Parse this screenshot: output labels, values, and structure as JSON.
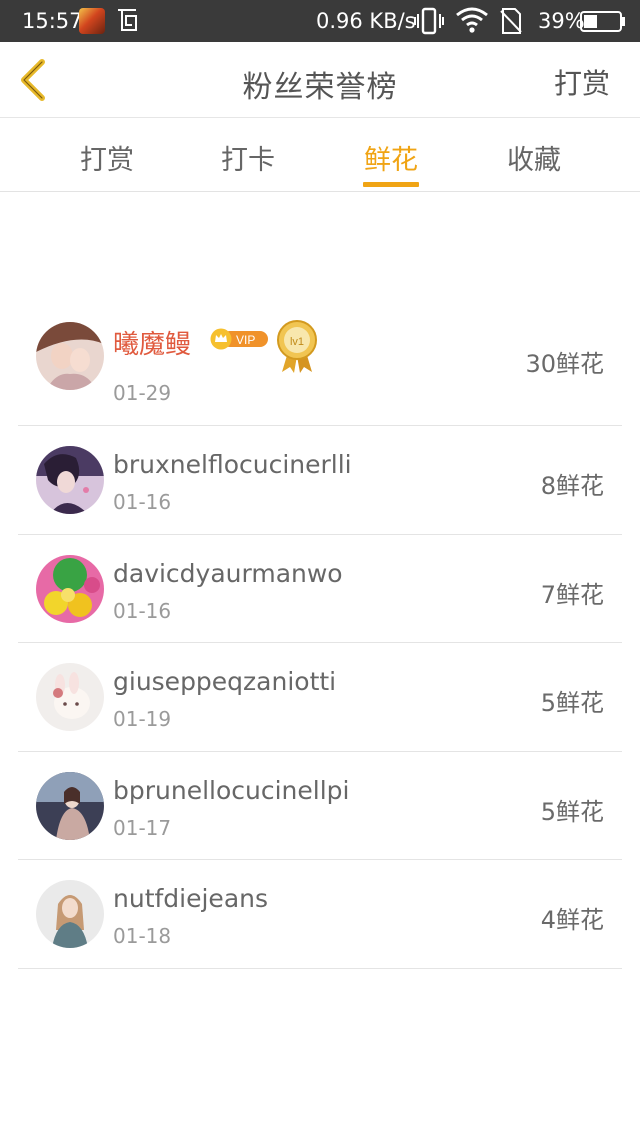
{
  "status_bar": {
    "time": "15:57",
    "speed": "0.96 KB/s",
    "battery_percent": "39%",
    "battery_level": 0.39,
    "icons": [
      "game-app-icon",
      "screenshot-icon",
      "vibrate-icon",
      "wifi-icon",
      "no-sim-icon",
      "battery-icon"
    ]
  },
  "header": {
    "title": "粉丝荣誉榜",
    "action_label": "打赏",
    "back_icon": "chevron-left-icon"
  },
  "tabs": [
    {
      "label": "打赏",
      "active": false
    },
    {
      "label": "打卡",
      "active": false
    },
    {
      "label": "鲜花",
      "active": true
    },
    {
      "label": "收藏",
      "active": false
    }
  ],
  "colors": {
    "accent": "#f0a414",
    "vip_name": "#e05a3e",
    "status_bar_bg": "#3a3a3a"
  },
  "ranking": [
    {
      "name": "曦魔鳗",
      "date": "01-29",
      "count": "30鲜花",
      "vip": true,
      "vip_label": "VIP",
      "level_label": "lv1"
    },
    {
      "name": "bruxnelflocucinerlli",
      "date": "01-16",
      "count": "8鲜花"
    },
    {
      "name": "davicdyaurmanwo",
      "date": "01-16",
      "count": "7鲜花"
    },
    {
      "name": "giuseppeqzaniotti",
      "date": "01-19",
      "count": "5鲜花"
    },
    {
      "name": "bprunellocucinellpi",
      "date": "01-17",
      "count": "5鲜花"
    },
    {
      "name": "nutfdiejeans",
      "date": "01-18",
      "count": "4鲜花"
    }
  ]
}
